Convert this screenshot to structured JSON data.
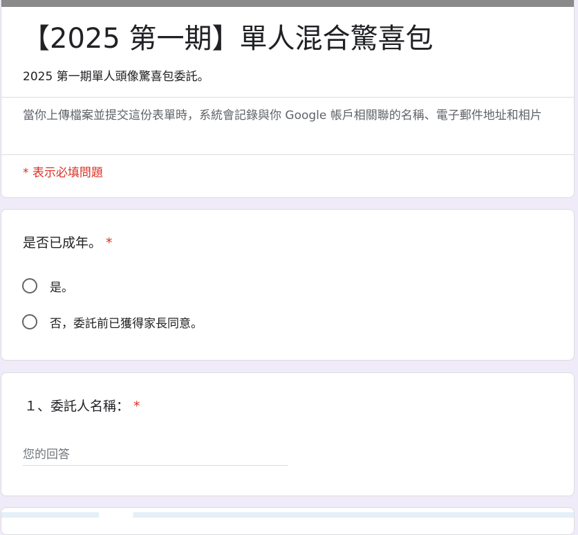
{
  "form": {
    "title": "【2025 第一期】單人混合驚喜包",
    "description": "2025 第一期單人頭像驚喜包委託。",
    "notice": "當你上傳檔案並提交這份表單時，系統會記錄與你 Google 帳戶相關聯的名稱、電子郵件地址和相片",
    "required_note": "* 表示必填問題"
  },
  "questions": {
    "adult": {
      "title": "是否已成年。",
      "required_mark": "*",
      "options": [
        {
          "label": "是。"
        },
        {
          "label": "否，委託前已獲得家長同意。"
        }
      ]
    },
    "client_name": {
      "title": "１、委託人名稱：",
      "required_mark": "*",
      "placeholder": "您的回答",
      "value": ""
    }
  },
  "colors": {
    "page_background": "#f0ebf8",
    "header_bar": "#8a8a8a",
    "required": "#d93025",
    "secondary_text": "#5f6368",
    "border": "#dadce0"
  }
}
